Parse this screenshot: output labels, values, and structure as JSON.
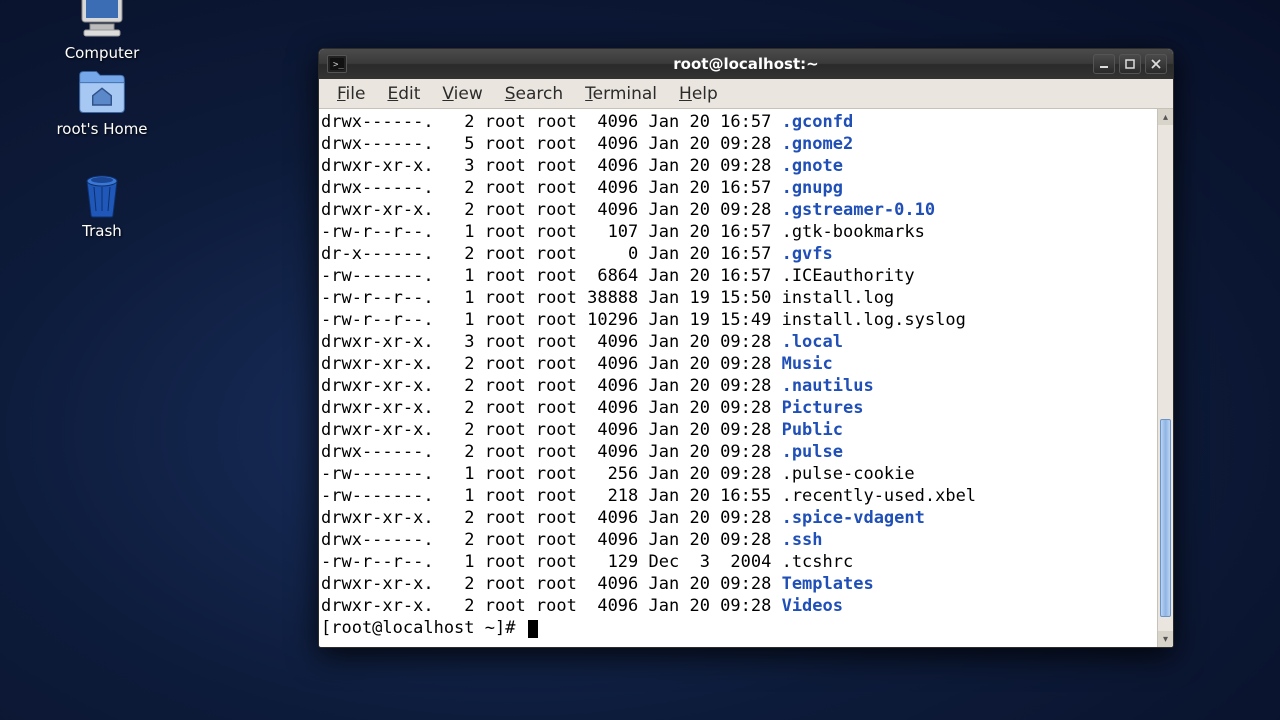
{
  "desktop": {
    "icons": [
      {
        "name": "computer",
        "label": "Computer"
      },
      {
        "name": "home",
        "label": "root's Home"
      },
      {
        "name": "trash",
        "label": "Trash"
      }
    ]
  },
  "window": {
    "title": "root@localhost:~",
    "menu": [
      "File",
      "Edit",
      "View",
      "Search",
      "Terminal",
      "Help"
    ],
    "prompt": "[root@localhost ~]# ",
    "listing": [
      {
        "perm": "drwx------.",
        "ln": "2",
        "own": "root",
        "grp": "root",
        "size": "4096",
        "date": "Jan 20 16:57",
        "name": ".gconfd",
        "dir": true
      },
      {
        "perm": "drwx------.",
        "ln": "5",
        "own": "root",
        "grp": "root",
        "size": "4096",
        "date": "Jan 20 09:28",
        "name": ".gnome2",
        "dir": true
      },
      {
        "perm": "drwxr-xr-x.",
        "ln": "3",
        "own": "root",
        "grp": "root",
        "size": "4096",
        "date": "Jan 20 09:28",
        "name": ".gnote",
        "dir": true
      },
      {
        "perm": "drwx------.",
        "ln": "2",
        "own": "root",
        "grp": "root",
        "size": "4096",
        "date": "Jan 20 16:57",
        "name": ".gnupg",
        "dir": true
      },
      {
        "perm": "drwxr-xr-x.",
        "ln": "2",
        "own": "root",
        "grp": "root",
        "size": "4096",
        "date": "Jan 20 09:28",
        "name": ".gstreamer-0.10",
        "dir": true
      },
      {
        "perm": "-rw-r--r--.",
        "ln": "1",
        "own": "root",
        "grp": "root",
        "size": "107",
        "date": "Jan 20 16:57",
        "name": ".gtk-bookmarks",
        "dir": false
      },
      {
        "perm": "dr-x------.",
        "ln": "2",
        "own": "root",
        "grp": "root",
        "size": "0",
        "date": "Jan 20 16:57",
        "name": ".gvfs",
        "dir": true
      },
      {
        "perm": "-rw-------.",
        "ln": "1",
        "own": "root",
        "grp": "root",
        "size": "6864",
        "date": "Jan 20 16:57",
        "name": ".ICEauthority",
        "dir": false
      },
      {
        "perm": "-rw-r--r--.",
        "ln": "1",
        "own": "root",
        "grp": "root",
        "size": "38888",
        "date": "Jan 19 15:50",
        "name": "install.log",
        "dir": false
      },
      {
        "perm": "-rw-r--r--.",
        "ln": "1",
        "own": "root",
        "grp": "root",
        "size": "10296",
        "date": "Jan 19 15:49",
        "name": "install.log.syslog",
        "dir": false
      },
      {
        "perm": "drwxr-xr-x.",
        "ln": "3",
        "own": "root",
        "grp": "root",
        "size": "4096",
        "date": "Jan 20 09:28",
        "name": ".local",
        "dir": true
      },
      {
        "perm": "drwxr-xr-x.",
        "ln": "2",
        "own": "root",
        "grp": "root",
        "size": "4096",
        "date": "Jan 20 09:28",
        "name": "Music",
        "dir": true
      },
      {
        "perm": "drwxr-xr-x.",
        "ln": "2",
        "own": "root",
        "grp": "root",
        "size": "4096",
        "date": "Jan 20 09:28",
        "name": ".nautilus",
        "dir": true
      },
      {
        "perm": "drwxr-xr-x.",
        "ln": "2",
        "own": "root",
        "grp": "root",
        "size": "4096",
        "date": "Jan 20 09:28",
        "name": "Pictures",
        "dir": true
      },
      {
        "perm": "drwxr-xr-x.",
        "ln": "2",
        "own": "root",
        "grp": "root",
        "size": "4096",
        "date": "Jan 20 09:28",
        "name": "Public",
        "dir": true
      },
      {
        "perm": "drwx------.",
        "ln": "2",
        "own": "root",
        "grp": "root",
        "size": "4096",
        "date": "Jan 20 09:28",
        "name": ".pulse",
        "dir": true
      },
      {
        "perm": "-rw-------.",
        "ln": "1",
        "own": "root",
        "grp": "root",
        "size": "256",
        "date": "Jan 20 09:28",
        "name": ".pulse-cookie",
        "dir": false
      },
      {
        "perm": "-rw-------.",
        "ln": "1",
        "own": "root",
        "grp": "root",
        "size": "218",
        "date": "Jan 20 16:55",
        "name": ".recently-used.xbel",
        "dir": false
      },
      {
        "perm": "drwxr-xr-x.",
        "ln": "2",
        "own": "root",
        "grp": "root",
        "size": "4096",
        "date": "Jan 20 09:28",
        "name": ".spice-vdagent",
        "dir": true
      },
      {
        "perm": "drwx------.",
        "ln": "2",
        "own": "root",
        "grp": "root",
        "size": "4096",
        "date": "Jan 20 09:28",
        "name": ".ssh",
        "dir": true
      },
      {
        "perm": "-rw-r--r--.",
        "ln": "1",
        "own": "root",
        "grp": "root",
        "size": "129",
        "date": "Dec  3  2004",
        "name": ".tcshrc",
        "dir": false
      },
      {
        "perm": "drwxr-xr-x.",
        "ln": "2",
        "own": "root",
        "grp": "root",
        "size": "4096",
        "date": "Jan 20 09:28",
        "name": "Templates",
        "dir": true
      },
      {
        "perm": "drwxr-xr-x.",
        "ln": "2",
        "own": "root",
        "grp": "root",
        "size": "4096",
        "date": "Jan 20 09:28",
        "name": "Videos",
        "dir": true
      }
    ]
  }
}
